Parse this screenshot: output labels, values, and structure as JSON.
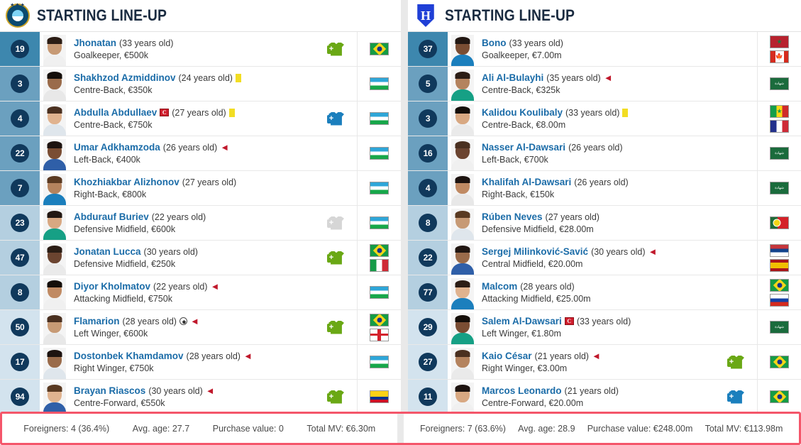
{
  "colors": {
    "player_name": "#1b6ca8",
    "number_badge": "#10395c",
    "sub_on_green": "#6aa815",
    "sub_on_blue": "#1b7fbd",
    "yellow_card": "#f2dd23",
    "red_arrow": "#c0192c",
    "footer_highlight": "#f4566a"
  },
  "columns": [
    {
      "header": {
        "title": "STARTING LINE-UP",
        "crest_icon": "pakhtakor-crest-icon"
      },
      "players": [
        {
          "number": "19",
          "name": "Jhonatan",
          "age": "(33 years old)",
          "position_value": "Goalkeeper, €500k",
          "group": "gk",
          "badges": [],
          "sub_icon": "substitute-in-green-icon",
          "flags": [
            "brazil-flag"
          ]
        },
        {
          "number": "3",
          "name": "Shakhzod Azmiddinov",
          "age": "(24 years old)",
          "position_value": "Centre-Back, €350k",
          "group": "def",
          "badges": [
            "yellow-card"
          ],
          "sub_icon": "",
          "flags": [
            "uzbekistan-flag"
          ]
        },
        {
          "number": "4",
          "name": "Abdulla Abdullaev",
          "age": "(27 years old)",
          "position_value": "Centre-Back, €750k",
          "group": "def",
          "badges": [
            "captain",
            "yellow-card"
          ],
          "sub_icon": "substitute-in-blue-icon",
          "flags": [
            "uzbekistan-flag"
          ]
        },
        {
          "number": "22",
          "name": "Umar Adkhamzoda",
          "age": "(26 years old)",
          "position_value": "Left-Back, €400k",
          "group": "def",
          "badges": [
            "substituted-off"
          ],
          "sub_icon": "",
          "flags": [
            "uzbekistan-flag"
          ]
        },
        {
          "number": "7",
          "name": "Khozhiakbar Alizhonov",
          "age": "(27 years old)",
          "position_value": "Right-Back, €800k",
          "group": "def",
          "badges": [],
          "sub_icon": "",
          "flags": [
            "uzbekistan-flag"
          ]
        },
        {
          "number": "23",
          "name": "Abdurauf Buriev",
          "age": "(22 years old)",
          "position_value": "Defensive Midfield, €600k",
          "group": "mid",
          "badges": [],
          "sub_icon": "substitute-in-grey-icon",
          "flags": [
            "uzbekistan-flag"
          ]
        },
        {
          "number": "47",
          "name": "Jonatan Lucca",
          "age": "(30 years old)",
          "position_value": "Defensive Midfield, €250k",
          "group": "mid",
          "badges": [],
          "sub_icon": "substitute-in-green-icon",
          "flags": [
            "brazil-flag",
            "italy-flag"
          ]
        },
        {
          "number": "8",
          "name": "Diyor Kholmatov",
          "age": "(22 years old)",
          "position_value": "Attacking Midfield, €750k",
          "group": "mid",
          "badges": [
            "substituted-off"
          ],
          "sub_icon": "",
          "flags": [
            "uzbekistan-flag"
          ]
        },
        {
          "number": "50",
          "name": "Flamarion",
          "age": "(28 years old)",
          "position_value": "Left Winger, €600k",
          "group": "att",
          "badges": [
            "goal",
            "substituted-off"
          ],
          "sub_icon": "substitute-in-green-icon",
          "flags": [
            "brazil-flag",
            "georgia-flag"
          ]
        },
        {
          "number": "17",
          "name": "Dostonbek Khamdamov",
          "age": "(28 years old)",
          "position_value": "Right Winger, €750k",
          "group": "att",
          "badges": [
            "substituted-off"
          ],
          "sub_icon": "",
          "flags": [
            "uzbekistan-flag"
          ]
        },
        {
          "number": "94",
          "name": "Brayan Riascos",
          "age": "(30 years old)",
          "position_value": "Centre-Forward, €550k",
          "group": "att",
          "badges": [
            "substituted-off"
          ],
          "sub_icon": "substitute-in-green-icon",
          "flags": [
            "colombia-flag"
          ]
        }
      ],
      "footer": {
        "foreigners": "Foreigners: 4 (36.4%)",
        "avg_age": "Avg. age: 27.7",
        "purchase_value": "Purchase value: 0",
        "total_mv": "Total MV: €6.30m"
      }
    },
    {
      "header": {
        "title": "STARTING LINE-UP",
        "crest_icon": "al-hilal-crest-icon"
      },
      "players": [
        {
          "number": "37",
          "name": "Bono",
          "age": "(33 years old)",
          "position_value": "Goalkeeper, €7.00m",
          "group": "gk",
          "badges": [],
          "sub_icon": "",
          "flags": [
            "morocco-flag",
            "canada-flag"
          ]
        },
        {
          "number": "5",
          "name": "Ali Al-Bulayhi",
          "age": "(35 years old)",
          "position_value": "Centre-Back, €325k",
          "group": "def",
          "badges": [
            "substituted-off"
          ],
          "sub_icon": "",
          "flags": [
            "saudi-arabia-flag"
          ]
        },
        {
          "number": "3",
          "name": "Kalidou Koulibaly",
          "age": "(33 years old)",
          "position_value": "Centre-Back, €8.00m",
          "group": "def",
          "badges": [
            "yellow-card"
          ],
          "sub_icon": "",
          "flags": [
            "senegal-flag",
            "france-flag"
          ]
        },
        {
          "number": "16",
          "name": "Nasser Al-Dawsari",
          "age": "(26 years old)",
          "position_value": "Left-Back, €700k",
          "group": "def",
          "badges": [],
          "sub_icon": "",
          "flags": [
            "saudi-arabia-flag"
          ]
        },
        {
          "number": "4",
          "name": "Khalifah Al-Dawsari",
          "age": "(26 years old)",
          "position_value": "Right-Back, €150k",
          "group": "def",
          "badges": [],
          "sub_icon": "",
          "flags": [
            "saudi-arabia-flag"
          ]
        },
        {
          "number": "8",
          "name": "Rúben Neves",
          "age": "(27 years old)",
          "position_value": "Defensive Midfield, €28.00m",
          "group": "mid",
          "badges": [],
          "sub_icon": "",
          "flags": [
            "portugal-flag"
          ]
        },
        {
          "number": "22",
          "name": "Sergej Milinković-Savić",
          "age": "(30 years old)",
          "position_value": "Central Midfield, €20.00m",
          "group": "mid",
          "badges": [
            "substituted-off"
          ],
          "sub_icon": "",
          "flags": [
            "serbia-flag",
            "spain-flag"
          ]
        },
        {
          "number": "77",
          "name": "Malcom",
          "age": "(28 years old)",
          "position_value": "Attacking Midfield, €25.00m",
          "group": "mid",
          "badges": [],
          "sub_icon": "",
          "flags": [
            "brazil-flag",
            "russia-flag"
          ]
        },
        {
          "number": "29",
          "name": "Salem Al-Dawsari",
          "age": "(33 years old)",
          "position_value": "Left Winger, €1.80m",
          "group": "att",
          "badges": [
            "captain"
          ],
          "sub_icon": "",
          "flags": [
            "saudi-arabia-flag"
          ]
        },
        {
          "number": "27",
          "name": "Kaio César",
          "age": "(21 years old)",
          "position_value": "Right Winger, €3.00m",
          "group": "att",
          "badges": [
            "substituted-off"
          ],
          "sub_icon": "substitute-in-green-icon",
          "flags": [
            "brazil-flag"
          ]
        },
        {
          "number": "11",
          "name": "Marcos Leonardo",
          "age": "(21 years old)",
          "position_value": "Centre-Forward, €20.00m",
          "group": "att",
          "badges": [],
          "sub_icon": "substitute-in-blue-icon",
          "flags": [
            "brazil-flag"
          ]
        }
      ],
      "footer": {
        "foreigners": "Foreigners: 7 (63.6%)",
        "avg_age": "Avg. age: 28.9",
        "purchase_value": "Purchase value: €248.00m",
        "total_mv": "Total MV: €113.98m"
      }
    }
  ]
}
